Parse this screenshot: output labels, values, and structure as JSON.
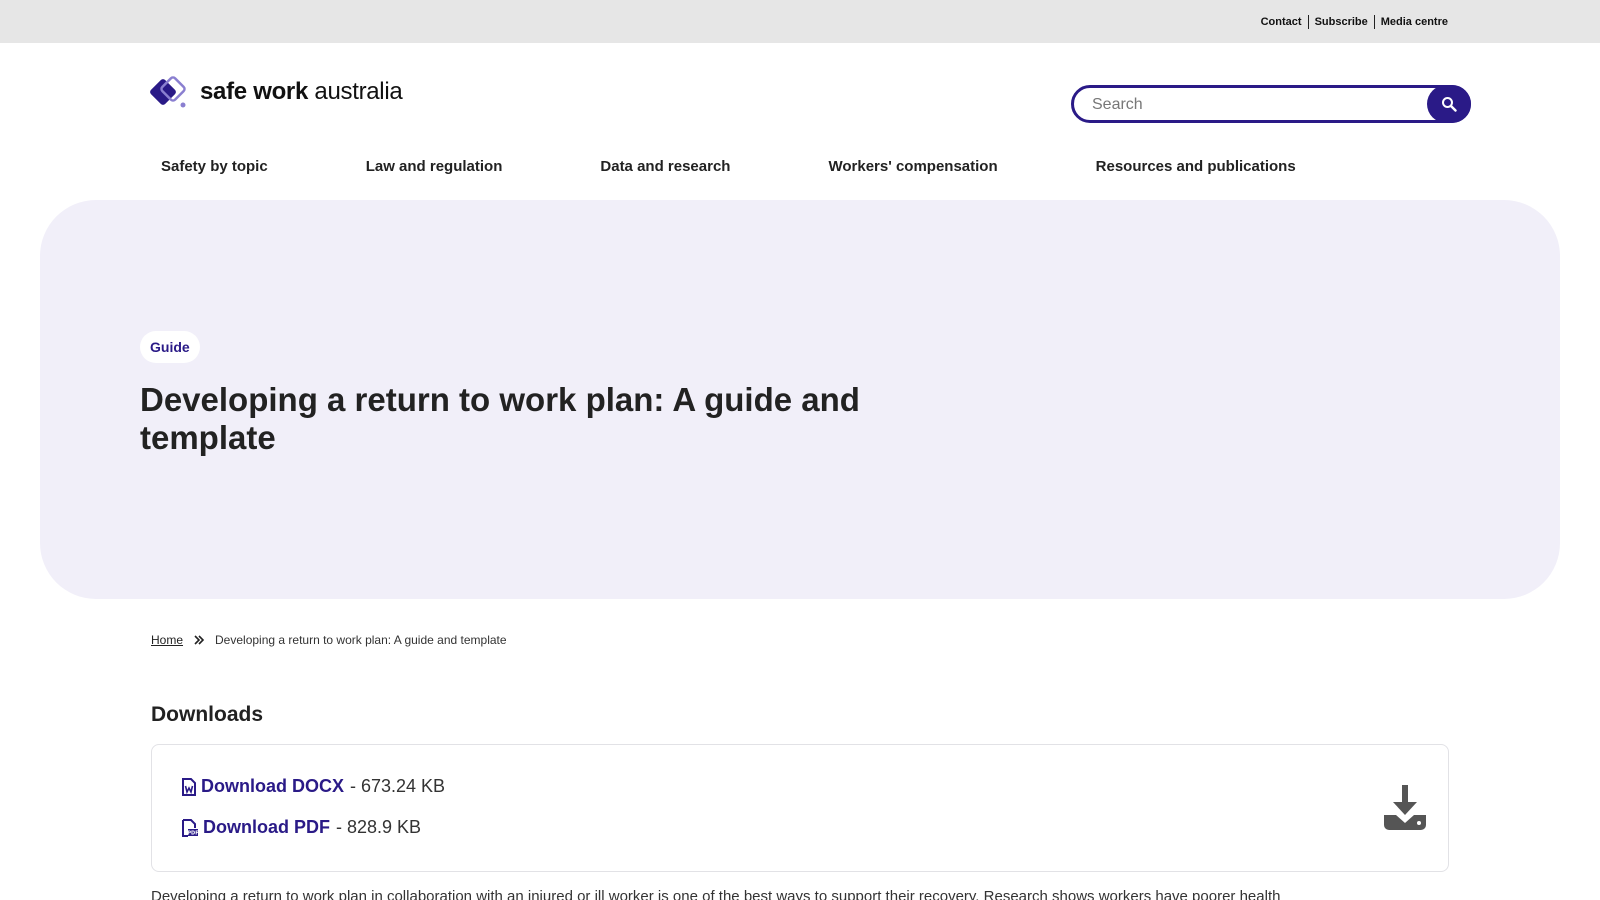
{
  "utility": {
    "contact": "Contact",
    "subscribe": "Subscribe",
    "media": "Media centre"
  },
  "brand": {
    "name_bold": "safe work",
    "name_light": " australia",
    "accent": "#2a1a87",
    "hero_bg": "#f1eff9"
  },
  "search": {
    "placeholder": "Search",
    "icon": "search-icon"
  },
  "nav": {
    "items": [
      "Safety by topic",
      "Law and regulation",
      "Data and research",
      "Workers' compensation",
      "Resources and publications"
    ]
  },
  "hero": {
    "badge": "Guide",
    "title": "Developing a return to work plan: A guide and template"
  },
  "breadcrumb": {
    "home": "Home",
    "current": "Developing a return to work plan: A guide and template"
  },
  "downloads": {
    "heading": "Downloads",
    "items": [
      {
        "label": "Download DOCX",
        "size": "- 673.24 KB",
        "icon": "docx-file-icon"
      },
      {
        "label": "Download PDF",
        "size": "- 828.9 KB",
        "icon": "pdf-file-icon"
      }
    ]
  },
  "intro": {
    "text": "Developing a return to work plan in collaboration with an injured or ill worker is one of the best ways to support their recovery. Research shows workers have poorer health"
  }
}
